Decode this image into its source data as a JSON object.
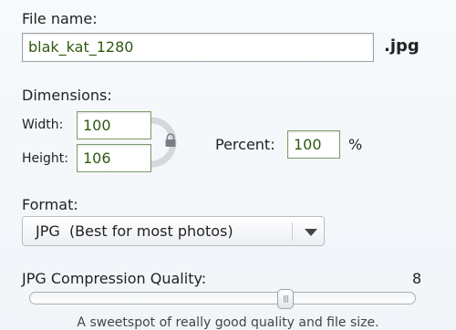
{
  "file": {
    "label": "File name:",
    "value": "blak_kat_1280",
    "extension": ".jpg"
  },
  "dimensions": {
    "label": "Dimensions:",
    "width_label": "Width:",
    "width_value": "100",
    "height_label": "Height:",
    "height_value": "106",
    "percent_label": "Percent:",
    "percent_value": "100",
    "percent_unit": "%",
    "lock_icon": "lock-icon"
  },
  "format": {
    "label": "Format:",
    "selected": "JPG  (Best for most photos)",
    "dropdown_icon": "chevron-down-icon"
  },
  "quality": {
    "label": "JPG Compression Quality:",
    "value_text": "8",
    "value": 8,
    "min": 0,
    "max": 12,
    "hint": "A sweetspot of really good quality and file size."
  },
  "colors": {
    "input_text": "#2e5a12",
    "background": "#f4f7fa"
  }
}
